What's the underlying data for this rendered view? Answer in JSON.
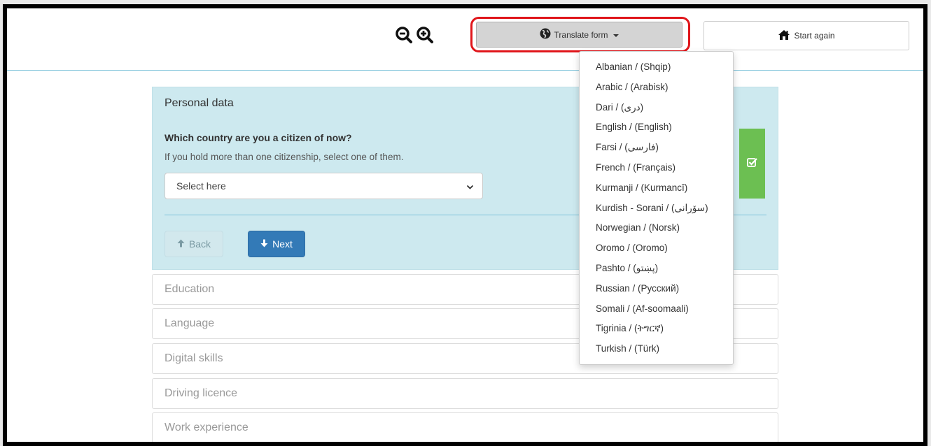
{
  "header": {
    "translate_label": "Translate form",
    "start_again_label": "Start again"
  },
  "language_menu": [
    "Albanian / (Shqip)",
    "Arabic / (Arabisk)",
    "Dari / (دری)",
    "English / (English)",
    "Farsi / (فارسی)",
    "French / (Français)",
    "Kurmanji / (Kurmancî)",
    "Kurdish - Sorani / (سۆرانی)",
    "Norwegian / (Norsk)",
    "Oromo / (Oromo)",
    "Pashto / (پښتو)",
    "Russian / (Русский)",
    "Somali / (Af-soomaali)",
    "Tigrinia / (ትግርኛ)",
    "Turkish / (Türk)"
  ],
  "form": {
    "active_section": {
      "title": "Personal data",
      "question": "Which country are you a citizen of now?",
      "hint": "If you hold more than one citizenship, select one of them.",
      "select_value": "Select here",
      "back_label": "Back",
      "next_label": "Next"
    },
    "sections": [
      "Education",
      "Language",
      "Digital skills",
      "Driving licence",
      "Work experience"
    ]
  },
  "colors": {
    "accent_blue": "#337ab7",
    "panel_bg": "#cde9ef",
    "complete_green": "#6cbf52",
    "highlight_red": "#e0161b"
  }
}
